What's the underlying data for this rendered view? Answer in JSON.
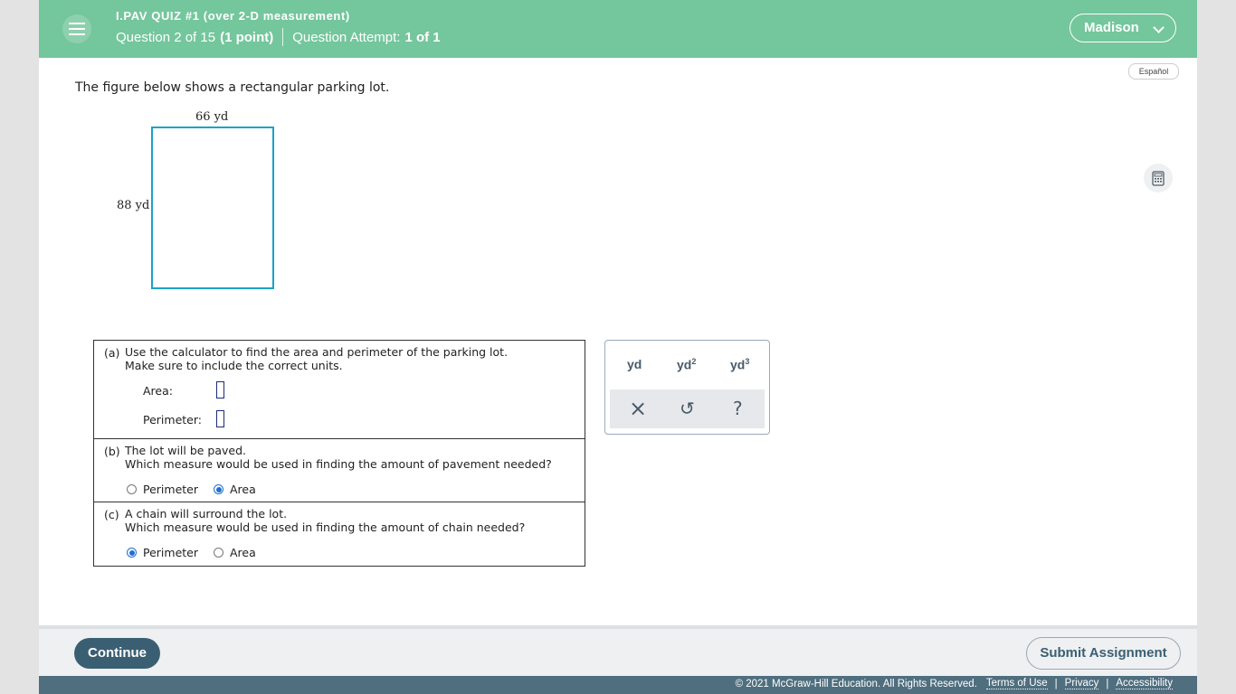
{
  "header": {
    "quiz_title": "I.PAV QUIZ #1 (over 2-D measurement)",
    "question_label": "Question 2 of 15",
    "points": "(1 point)",
    "attempt_label": "Question Attempt:",
    "attempt_value": "1 of 1",
    "user_name": "Madison"
  },
  "language_button": "Español",
  "intro_text": "The figure below shows a rectangular parking lot.",
  "figure": {
    "width_label": "66 yd",
    "height_label": "88 yd"
  },
  "parts": {
    "a": {
      "tag": "(a)",
      "line1": "Use the calculator to find the area and perimeter of the parking lot.",
      "line2": "Make sure to include the correct units.",
      "area_label": "Area:",
      "perimeter_label": "Perimeter:"
    },
    "b": {
      "tag": "(b)",
      "line1": "The lot will be paved.",
      "line2": "Which measure would be used in finding the amount of pavement needed?",
      "option1": "Perimeter",
      "option2": "Area",
      "selected": "Area"
    },
    "c": {
      "tag": "(c)",
      "line1": "A chain will surround the lot.",
      "line2": "Which measure would be used in finding the amount of chain needed?",
      "option1": "Perimeter",
      "option2": "Area",
      "selected": "Perimeter"
    }
  },
  "units_palette": {
    "unit1": "yd",
    "unit2_base": "yd",
    "unit2_exp": "2",
    "unit3_base": "yd",
    "unit3_exp": "3",
    "clear_icon": "×",
    "undo_icon": "↺",
    "help_icon": "?"
  },
  "footer": {
    "continue_label": "Continue",
    "submit_label": "Submit Assignment",
    "copyright": "© 2021 McGraw-Hill Education. All Rights Reserved.",
    "terms": "Terms of Use",
    "privacy": "Privacy",
    "accessibility": "Accessibility"
  },
  "colors": {
    "header_bg": "#74c69c",
    "lot_border": "#1aa3c8",
    "continue_bg": "#3b5f72",
    "legal_bg": "#4f6e7e"
  }
}
